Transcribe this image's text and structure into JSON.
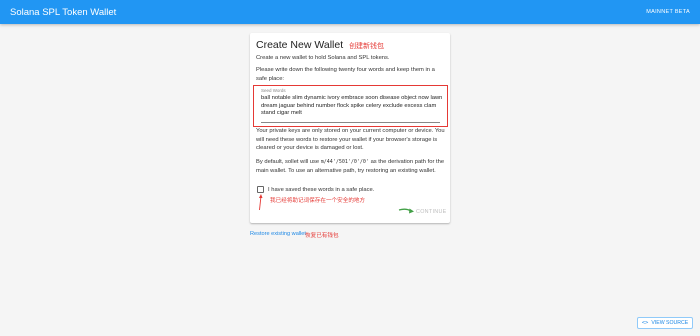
{
  "header": {
    "title": "Solana SPL Token Wallet",
    "network": "MAINNET BETA"
  },
  "card": {
    "title": "Create New Wallet",
    "title_annotation": "创建新钱包",
    "intro": "Create a new wallet to hold Solana and SPL tokens.",
    "instruction": "Please write down the following twenty four words and keep them in a safe place:",
    "seed_label": "Seed Words",
    "seed_words": "ball notable slim dynamic ivory embrace soon disease object now lawn dream jaguar behind number flock spike celery exclude excess clam stand cigar melt",
    "private_notice": "Your private keys are only stored on your current computer or device. You will need these words to restore your wallet if your browser's storage is cleared or your device is damaged or lost.",
    "derivation_prefix": "By default, sollet will use",
    "derivation_path": "m/44'/501'/0'/0'",
    "derivation_suffix": "as the derivation path for the main wallet. To use an alternative path, try restoring an existing wallet.",
    "checkbox_label": "I have saved these words in a safe place.",
    "checkbox_annotation": "我已经将助记词保存在一个安全的地方",
    "continue_label": "CONTINUE"
  },
  "restore": {
    "link_label": "Restore existing wallet",
    "annotation": "恢复已有钱包"
  },
  "footer": {
    "view_source_label": "VIEW SOURCE",
    "view_source_icon": "code-icon"
  },
  "colors": {
    "appbar": "#2196f3",
    "annotation": "#e53935",
    "arrow": "#43a047",
    "link": "#1e88e5"
  }
}
